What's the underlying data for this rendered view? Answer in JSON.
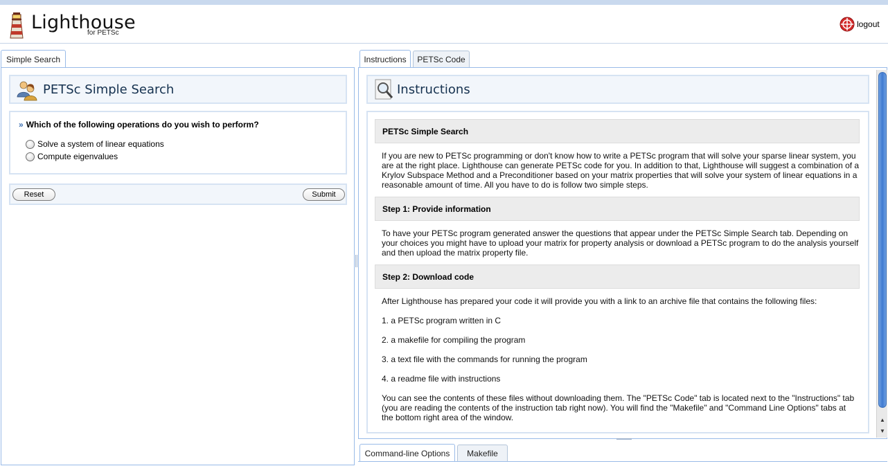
{
  "app": {
    "title": "Lighthouse",
    "subtitle": "for PETSc",
    "logout_label": "logout"
  },
  "left_tabs": [
    {
      "label": "Simple Search",
      "active": true
    }
  ],
  "simple_search": {
    "title": "PETSc Simple Search",
    "question": "Which of the following operations do you wish to perform?",
    "options": [
      {
        "label": "Solve a system of linear equations",
        "selected": false
      },
      {
        "label": "Compute eigenvalues",
        "selected": false
      }
    ],
    "reset_label": "Reset",
    "submit_label": "Submit"
  },
  "right_tabs": [
    {
      "label": "Instructions",
      "active": true
    },
    {
      "label": "PETSc Code",
      "active": false
    }
  ],
  "instructions": {
    "title": "Instructions",
    "sections": [
      {
        "heading": "PETSc Simple Search",
        "paragraphs": [
          "If you are new to PETSc programming or don't know how to write a PETSc program that will solve your sparse linear system, you are at the right place. Lighthouse can generate PETSc code for you. In addition to that, Lighthouse will suggest a combination of a Krylov Subspace Method and a Preconditioner based on your matrix properties that will solve your system of linear equations in a reasonable amount of time. All you have to do is follow two simple steps."
        ]
      },
      {
        "heading": "Step 1: Provide information",
        "paragraphs": [
          "To have your PETSc program generated answer the questions that appear under the PETSc Simple Search tab. Depending on your choices you might have to upload your matrix for property analysis or download a PETSc program to do the analysis yourself and then upload the matrix property file."
        ]
      },
      {
        "heading": "Step 2: Download code",
        "paragraphs": [
          "After Lighthouse has prepared your code it will provide you with a link to an archive file that contains the following files:",
          "1. a PETSc program written in C",
          "2. a makefile for compiling the program",
          "3. a text file with the commands for running the program",
          "4. a readme file with instructions",
          "You can see the contents of these files without downloading them. The \"PETSc Code\" tab is located next to the \"Instructions\" tab (you are reading the contents of the instruction tab right now). You will find the \"Makefile\" and \"Command Line Options\" tabs at the bottom right area of the window."
        ]
      }
    ]
  },
  "bottom_tabs": [
    {
      "label": "Command-line Options",
      "active": true
    },
    {
      "label": "Makefile",
      "active": false
    }
  ],
  "colors": {
    "accent": "#99bbe8",
    "header_text": "#15314f",
    "scroll_thumb": "#3f7ad0"
  }
}
